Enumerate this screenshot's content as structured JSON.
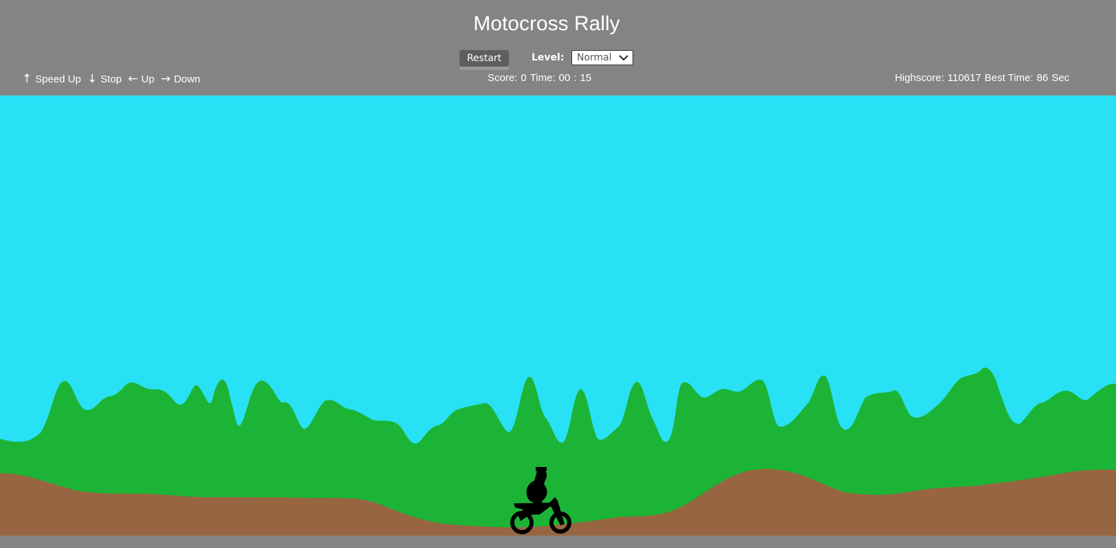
{
  "game": {
    "title": "Motocross Rally",
    "restart_label": "Restart",
    "level_label": "Level:",
    "level_selected": "Normal",
    "controls": {
      "up_key": "↑",
      "up_label": "Speed Up",
      "down_key": "↓",
      "down_label": "Stop",
      "left_key": "←",
      "left_label": "Up",
      "right_key": "→",
      "right_label": "Down"
    },
    "score_label": "Score:",
    "score_value": "0",
    "time_label": "Time:",
    "time_minutes": "00",
    "time_sep": ":",
    "time_seconds": "15",
    "highscore_label": "Highscore:",
    "highscore_value": "110617",
    "best_time_label": "Best Time:",
    "best_time_value": "86",
    "best_time_unit": "Sec"
  },
  "colors": {
    "sky": "#29e1f4",
    "hills": "#1cb436",
    "dirt": "#976640",
    "rider": "#000000",
    "chrome": "#868482"
  }
}
